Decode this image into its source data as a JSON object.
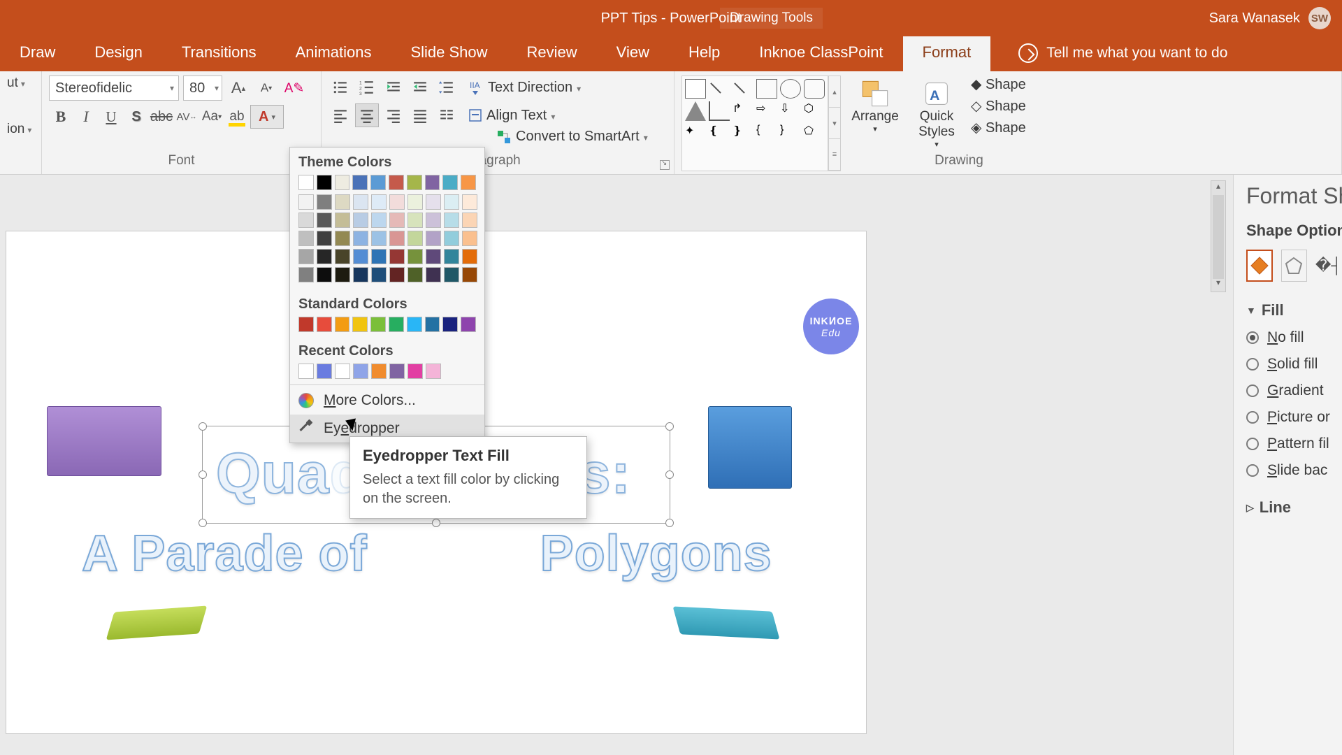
{
  "title": "PPT Tips  -  PowerPoint",
  "context_tab": "Drawing Tools",
  "user": {
    "name": "Sara Wanasek",
    "initials": "SW"
  },
  "tabs": [
    "Draw",
    "Design",
    "Transitions",
    "Animations",
    "Slide Show",
    "Review",
    "View",
    "Help",
    "Inknoe ClassPoint",
    "Format"
  ],
  "active_tab_index": 9,
  "tell_me": "Tell me what you want to do",
  "clipboard": {
    "cut": "ut",
    "copy": "ion"
  },
  "font": {
    "name": "Stereofidelic",
    "size": "80",
    "group_label": "Font"
  },
  "paragraph": {
    "group_label": "Paragraph",
    "text_direction": "Text Direction",
    "align_text": "Align Text",
    "convert": "Convert to SmartArt"
  },
  "drawing": {
    "group_label": "Drawing",
    "arrange": "Arrange",
    "quick_styles": "Quick\nStyles",
    "shape_fill": "Shape",
    "shape_outline": "Shape",
    "shape_effects": "Shape"
  },
  "color_dd": {
    "theme_colors_label": "Theme Colors",
    "theme_row": [
      "#ffffff",
      "#000000",
      "#eeece1",
      "#4a72b8",
      "#5b9bd5",
      "#c55a4b",
      "#a5b64a",
      "#8064a2",
      "#4bacc6",
      "#f79646"
    ],
    "tints": [
      [
        "#f2f2f2",
        "#7f7f7f",
        "#ddd9c3",
        "#dbe5f1",
        "#deebf7",
        "#f2dcdb",
        "#ebf1dd",
        "#e5e0ec",
        "#dbeef3",
        "#fdeada"
      ],
      [
        "#d9d9d9",
        "#595959",
        "#c4bd97",
        "#b8cce4",
        "#bdd7ee",
        "#e5b9b7",
        "#d7e3bc",
        "#ccc1d9",
        "#b7dde8",
        "#fbd5b5"
      ],
      [
        "#bfbfbf",
        "#404040",
        "#938953",
        "#8db3e2",
        "#9cc2e5",
        "#d99694",
        "#c3d69b",
        "#b2a2c7",
        "#92cddc",
        "#fac08f"
      ],
      [
        "#a6a6a6",
        "#262626",
        "#494429",
        "#548dd4",
        "#2e74b5",
        "#953734",
        "#76923c",
        "#5f497a",
        "#31859b",
        "#e36c09"
      ],
      [
        "#808080",
        "#0d0d0d",
        "#1d1b10",
        "#17365d",
        "#1f4e79",
        "#632423",
        "#4f6128",
        "#3f3151",
        "#205867",
        "#974806"
      ]
    ],
    "standard_colors_label": "Standard Colors",
    "standard_row": [
      "#c0392b",
      "#e74c3c",
      "#f39c12",
      "#f1c40f",
      "#7bbf3a",
      "#27ae60",
      "#29b6f6",
      "#2471a3",
      "#1a237e",
      "#8e44ad"
    ],
    "recent_colors_label": "Recent Colors",
    "recent_row": [
      "#ffffff",
      "#6a7ce0",
      "#ffffff",
      "#8fa4e8",
      "#f08c2e",
      "#8064a2",
      "#e23fa3",
      "#f4b4d8"
    ],
    "more_colors": "More Colors...",
    "eyedropper": "Eyedropper"
  },
  "tooltip": {
    "title": "Eyedropper Text Fill",
    "body": "Select a text fill color by clicking on the screen."
  },
  "slide": {
    "title_text": "Quadrilaterals:",
    "subtitle_text": "A Parade of       Polygons",
    "logo_line1": "INKͶOE",
    "logo_line2": "Edu"
  },
  "format_pane": {
    "title": "Format Sh",
    "options": "Shape Options",
    "fill_label": "Fill",
    "line_label": "Line",
    "radios": [
      "No fill",
      "Solid fill",
      "Gradient",
      "Picture or",
      "Pattern fil",
      "Slide bac"
    ],
    "checked_index": 0
  }
}
